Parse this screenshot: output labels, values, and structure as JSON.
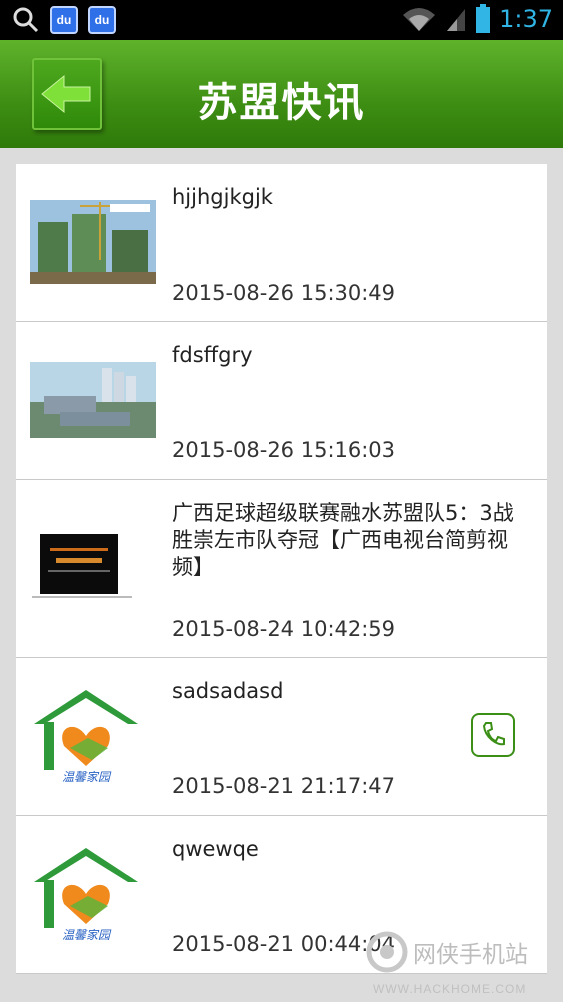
{
  "status_bar": {
    "time": "1:37"
  },
  "header": {
    "title": "苏盟快讯"
  },
  "items": [
    {
      "title": "hjjhgjkgjk",
      "date": "2015-08-26 15:30:49",
      "thumb": "building-construction"
    },
    {
      "title": "fdsffgry",
      "date": "2015-08-26 15:16:03",
      "thumb": "building-aerial"
    },
    {
      "title": "广西足球超级联赛融水苏盟队5：3战胜崇左市队夺冠【广西电视台简剪视频】",
      "date": "2015-08-24 10:42:59",
      "thumb": "video-screen"
    },
    {
      "title": "sadsadasd",
      "date": "2015-08-21 21:17:47",
      "thumb": "wenxin-jiayuan-logo"
    },
    {
      "title": "qwewqe",
      "date": "2015-08-21 00:44:04",
      "thumb": "wenxin-jiayuan-logo"
    }
  ],
  "logo_text": "温馨家园",
  "watermark": {
    "name": "网侠手机站",
    "url": "WWW.HACKHOME.COM"
  },
  "colors": {
    "header_green": "#3d8d13",
    "status_blue": "#31b5e5"
  }
}
